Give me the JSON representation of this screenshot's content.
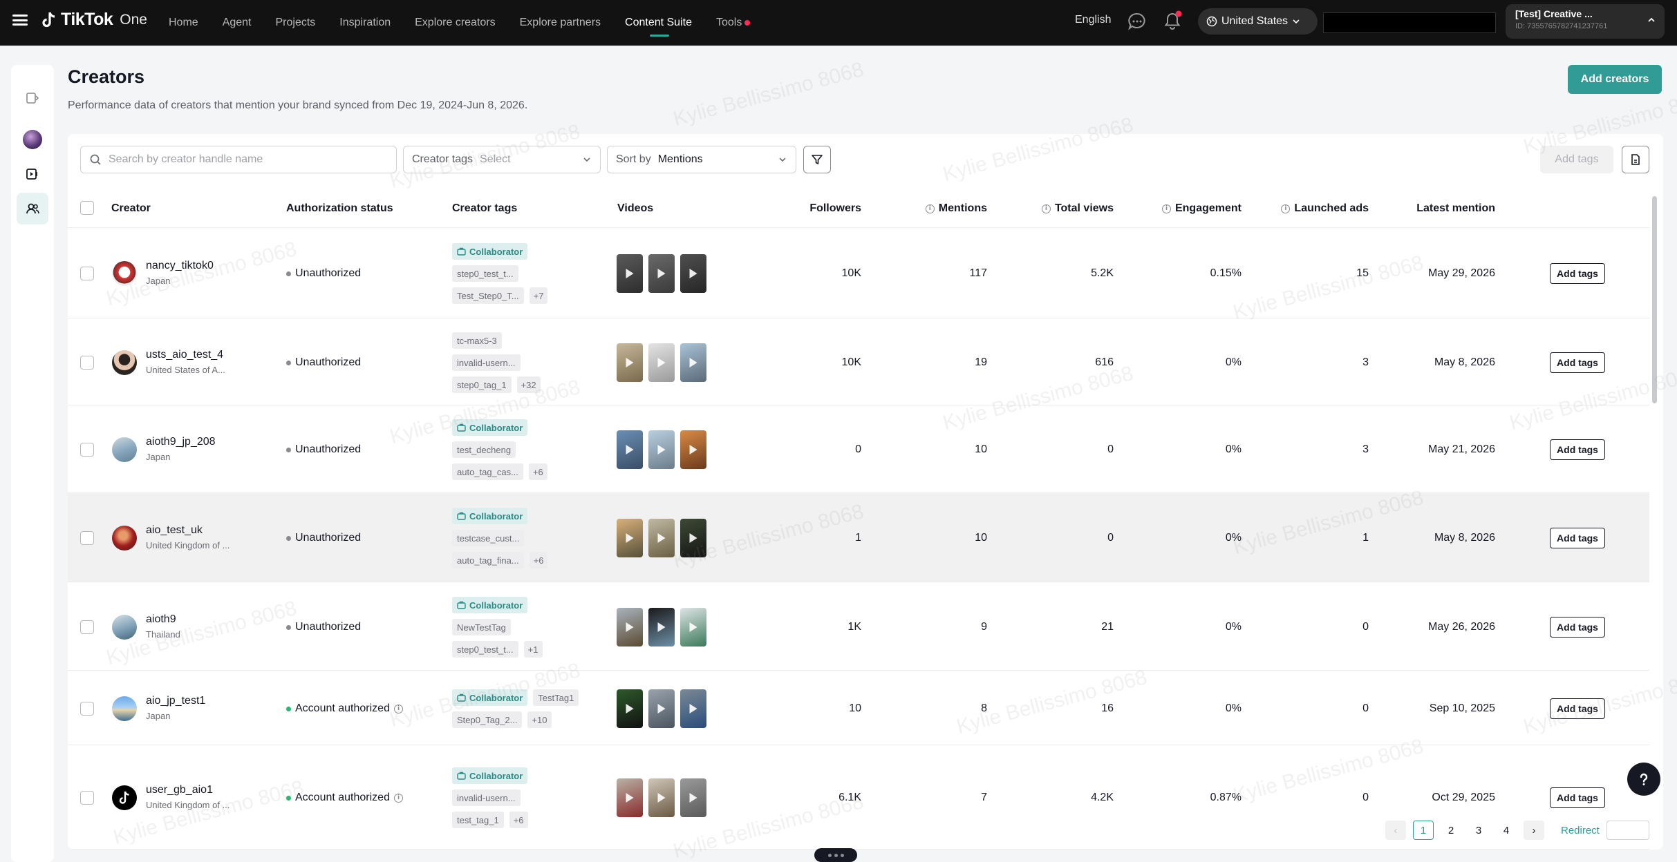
{
  "topbar": {
    "brand": "TikTok",
    "brand_suffix": "One",
    "nav": [
      "Home",
      "Agent",
      "Projects",
      "Inspiration",
      "Explore creators",
      "Explore partners",
      "Content Suite",
      "Tools"
    ],
    "active_nav": "Content Suite",
    "language": "English",
    "region": "United States",
    "account_name": "[Test] Creative ...",
    "account_id": "ID: 7355765782741237761"
  },
  "header": {
    "title": "Creators",
    "subtitle": "Performance data of creators that mention your brand synced from Dec 19, 2024-Jun 8, 2026.",
    "add_creators": "Add creators"
  },
  "toolbar": {
    "search_placeholder": "Search by creator handle name",
    "tags_label": "Creator tags",
    "tags_placeholder": "Select",
    "sort_label": "Sort by",
    "sort_value": "Mentions",
    "add_tags": "Add tags"
  },
  "columns": {
    "creator": "Creator",
    "auth": "Authorization status",
    "tags": "Creator tags",
    "videos": "Videos",
    "followers": "Followers",
    "mentions": "Mentions",
    "views": "Total views",
    "engagement": "Engagement",
    "ads": "Launched ads",
    "latest": "Latest mention"
  },
  "rows": [
    {
      "name": "nancy_tiktok0",
      "country": "Japan",
      "auth": "Unauthorized",
      "tag_lines": [
        [
          "Collaborator"
        ],
        [
          "step0_test_t..."
        ],
        [
          "Test_Step0_T...",
          "+7"
        ]
      ],
      "followers": "10K",
      "mentions": "117",
      "views": "5.2K",
      "engagement": "0.15%",
      "ads": "15",
      "latest": "May 29, 2026",
      "action": "Add tags"
    },
    {
      "name": "usts_aio_test_4",
      "country": "United States of A...",
      "auth": "Unauthorized",
      "tag_lines": [
        [
          "tc-max5-3"
        ],
        [
          "invalid-usern..."
        ],
        [
          "step0_tag_1",
          "+32"
        ]
      ],
      "followers": "10K",
      "mentions": "19",
      "views": "616",
      "engagement": "0%",
      "ads": "3",
      "latest": "May 8, 2026",
      "action": "Add tags"
    },
    {
      "name": "aioth9_jp_208",
      "country": "Japan",
      "auth": "Unauthorized",
      "tag_lines": [
        [
          "Collaborator"
        ],
        [
          "test_decheng"
        ],
        [
          "auto_tag_cas...",
          "+6"
        ]
      ],
      "followers": "0",
      "mentions": "10",
      "views": "0",
      "engagement": "0%",
      "ads": "3",
      "latest": "May 21, 2026",
      "action": "Add tags"
    },
    {
      "name": "aio_test_uk",
      "country": "United Kingdom of ...",
      "auth": "Unauthorized",
      "tag_lines": [
        [
          "Collaborator"
        ],
        [
          "testcase_cust..."
        ],
        [
          "auto_tag_fina...",
          "+6"
        ]
      ],
      "followers": "1",
      "mentions": "10",
      "views": "0",
      "engagement": "0%",
      "ads": "1",
      "latest": "May 8, 2026",
      "action": "Add tags"
    },
    {
      "name": "aioth9",
      "country": "Thailand",
      "auth": "Unauthorized",
      "tag_lines": [
        [
          "Collaborator"
        ],
        [
          "NewTestTag"
        ],
        [
          "step0_test_t...",
          "+1"
        ]
      ],
      "followers": "1K",
      "mentions": "9",
      "views": "21",
      "engagement": "0%",
      "ads": "0",
      "latest": "May 26, 2026",
      "action": "Add tags"
    },
    {
      "name": "aio_jp_test1",
      "country": "Japan",
      "auth": "Account authorized",
      "tag_lines": [
        [
          "Collaborator",
          "TestTag1"
        ],
        [
          "Step0_Tag_2...",
          "+10"
        ]
      ],
      "followers": "10",
      "mentions": "8",
      "views": "16",
      "engagement": "0%",
      "ads": "0",
      "latest": "Sep 10, 2025",
      "action": "Add tags"
    },
    {
      "name": "user_gb_aio1",
      "country": "United Kingdom of ...",
      "auth": "Account authorized",
      "tag_lines": [
        [
          "Collaborator"
        ],
        [
          "invalid-usern..."
        ],
        [
          "test_tag_1",
          "+6"
        ]
      ],
      "followers": "6.1K",
      "mentions": "7",
      "views": "4.2K",
      "engagement": "0.87%",
      "ads": "0",
      "latest": "Oct 29, 2025",
      "action": "Add tags"
    }
  ],
  "pagination": {
    "pages": [
      "1",
      "2",
      "3",
      "4"
    ],
    "current": "1",
    "redirect": "Redirect"
  },
  "watermark": "Kylie Bellissimo 8068",
  "colors": {
    "accent": "#319b95",
    "topbar": "#121212",
    "badge": "#fe2c55"
  }
}
